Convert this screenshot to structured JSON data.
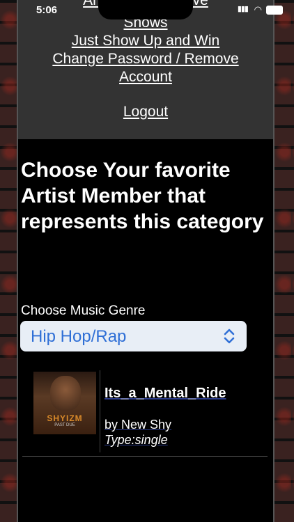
{
  "status": {
    "time": "5:06"
  },
  "menu": {
    "cut_off_text": "Amazon Interactive",
    "items": [
      "Shows",
      "Just Show Up and Win",
      "Change Password / Remove",
      "Account",
      "Logout"
    ]
  },
  "main": {
    "heading": "Choose Your favorite Artist Member that represents this category",
    "genre_label": "Choose Music Genre",
    "genre_selected": "Hip Hop/Rap"
  },
  "result": {
    "thumb_title": "SHYIZM",
    "thumb_sub": "PAST DUE",
    "song": "Its_a_Mental_Ride",
    "artist": "by New Shy",
    "type": "Type:single"
  },
  "colors": {
    "accent": "#2f6fd6",
    "menu_bg": "#333333",
    "panel_bg": "#000000"
  }
}
